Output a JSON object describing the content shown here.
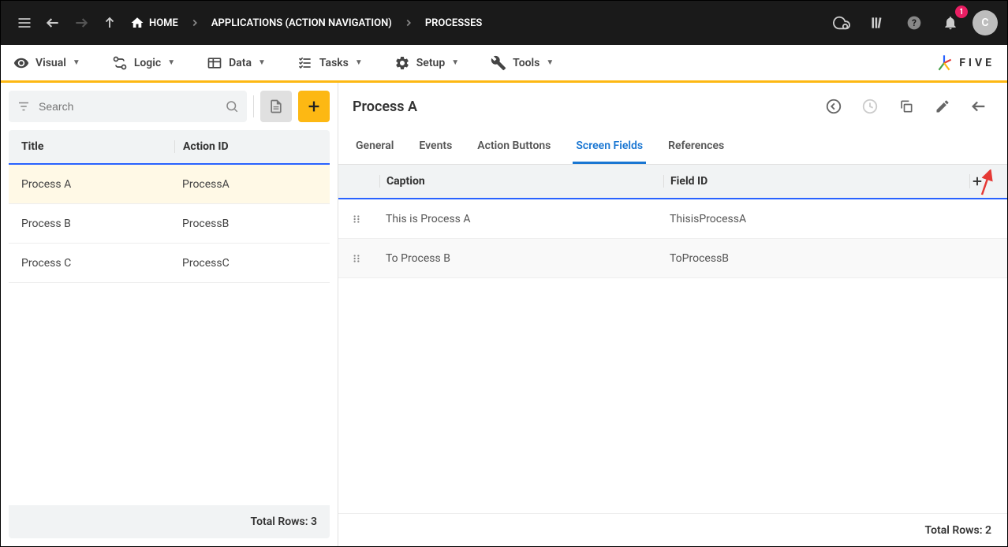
{
  "topbar": {
    "home_label": "HOME",
    "crumb1": "APPLICATIONS (ACTION NAVIGATION)",
    "crumb2": "PROCESSES",
    "avatar_initial": "C",
    "notif_count": "1"
  },
  "menubar": {
    "items": [
      {
        "label": "Visual"
      },
      {
        "label": "Logic"
      },
      {
        "label": "Data"
      },
      {
        "label": "Tasks"
      },
      {
        "label": "Setup"
      },
      {
        "label": "Tools"
      }
    ],
    "brand": "FIVE"
  },
  "left": {
    "search_placeholder": "Search",
    "columns": {
      "title": "Title",
      "action": "Action ID"
    },
    "rows": [
      {
        "title": "Process A",
        "action": "ProcessA",
        "selected": true
      },
      {
        "title": "Process B",
        "action": "ProcessB",
        "selected": false
      },
      {
        "title": "Process C",
        "action": "ProcessC",
        "selected": false
      }
    ],
    "footer": "Total Rows: 3"
  },
  "right": {
    "title": "Process A",
    "tabs": [
      {
        "label": "General",
        "active": false
      },
      {
        "label": "Events",
        "active": false
      },
      {
        "label": "Action Buttons",
        "active": false
      },
      {
        "label": "Screen Fields",
        "active": true
      },
      {
        "label": "References",
        "active": false
      }
    ],
    "columns": {
      "caption": "Caption",
      "field_id": "Field ID"
    },
    "rows": [
      {
        "caption": "This is Process A",
        "field_id": "ThisisProcessA"
      },
      {
        "caption": "To Process B",
        "field_id": "ToProcessB"
      }
    ],
    "footer": "Total Rows: 2"
  }
}
